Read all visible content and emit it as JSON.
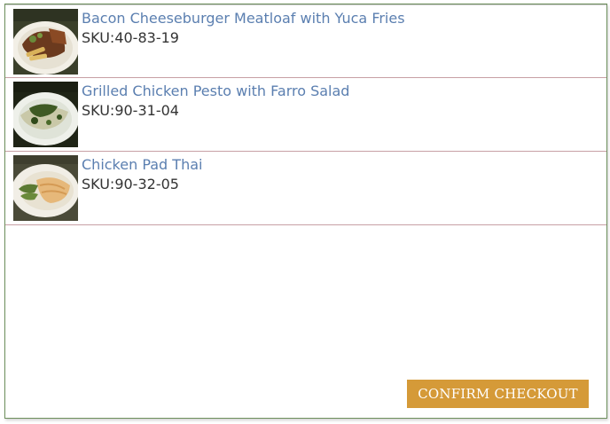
{
  "items": [
    {
      "name": "Bacon Cheeseburger Meatloaf with Yuca Fries",
      "sku": "SKU:40-83-19",
      "image": "meatloaf-dish-photo"
    },
    {
      "name": "Grilled Chicken Pesto with Farro Salad",
      "sku": "SKU:90-31-04",
      "image": "chicken-pesto-dish-photo"
    },
    {
      "name": "Chicken Pad Thai",
      "sku": "SKU:90-32-05",
      "image": "pad-thai-dish-photo"
    }
  ],
  "confirm_label": "CONFIRM CHECKOUT",
  "colors": {
    "link": "#5b7fb0",
    "button": "#d59a38",
    "panel_border": "#6d8f5c",
    "row_divider": "#c7a0a5"
  }
}
